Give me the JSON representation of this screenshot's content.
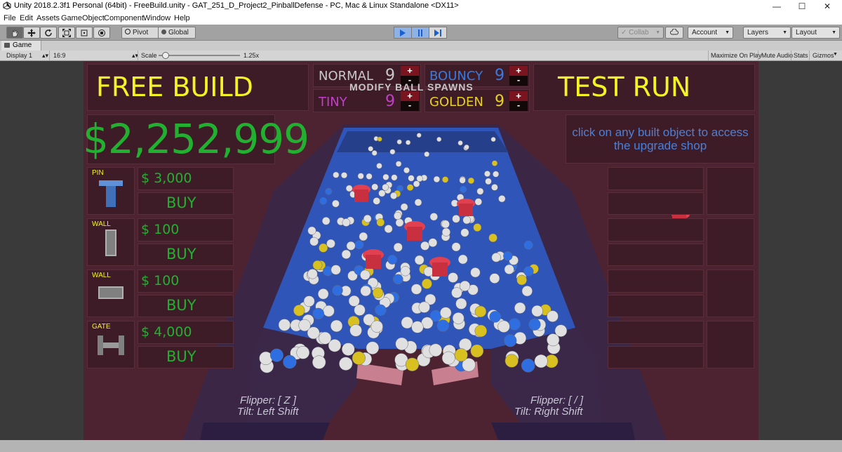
{
  "window": {
    "title": "Unity 2018.2.3f1 Personal (64bit) - FreeBuild.unity - GAT_251_D_Project2_PinballDefense - PC, Mac & Linux Standalone <DX11>",
    "minimize": "—",
    "maximize": "☐",
    "close": "✕"
  },
  "menu": [
    "File",
    "Edit",
    "Assets",
    "GameObject",
    "Component",
    "Window",
    "Help"
  ],
  "toolbar": {
    "pivot": "Pivot",
    "global": "Global",
    "collab": "Collab",
    "account": "Account",
    "layers": "Layers",
    "layout": "Layout"
  },
  "tab": {
    "label": "Game"
  },
  "gamebar": {
    "display": "Display 1",
    "aspect": "16:9",
    "scale_label": "Scale",
    "scale_value": "1.25x",
    "scale_level": 0.05,
    "maximize": "Maximize On Play",
    "mute": "Mute Audio",
    "stats": "Stats",
    "gizmos": "Gizmos"
  },
  "game": {
    "free_build": "FREE BUILD",
    "test_run": "TEST RUN",
    "modify_label": "MODIFY BALL SPAWNS",
    "spawns": [
      {
        "label": "NORMAL",
        "value": "9",
        "color": "#c8c8c8"
      },
      {
        "label": "BOUNCY",
        "value": "9",
        "color": "#3a7adc"
      },
      {
        "label": "TINY",
        "value": "9",
        "color": "#c040c8"
      },
      {
        "label": "GOLDEN",
        "value": "9",
        "color": "#e8d020"
      }
    ],
    "plus": "+",
    "minus": "-",
    "money": "$2,252,999",
    "upgrade_hint": "click on any built object to access the upgrade shop",
    "shop": [
      {
        "name": "PIN",
        "price": "$ 3,000",
        "buy": "BUY"
      },
      {
        "name": "WALL",
        "price": "$ 100",
        "buy": "BUY"
      },
      {
        "name": "WALL",
        "price": "$ 100",
        "buy": "BUY"
      },
      {
        "name": "GATE",
        "price": "$ 4,000",
        "buy": "BUY"
      }
    ],
    "left_hint": {
      "flipper": "Flipper: [ Z ]",
      "tilt": "Tilt: Left Shift"
    },
    "right_hint": {
      "flipper": "Flipper: [ / ]",
      "tilt": "Tilt: Right Shift"
    }
  },
  "colors": {
    "accent_yellow": "#f4f424",
    "money_green": "#22b030",
    "play_blue": "#1a5fd0"
  }
}
